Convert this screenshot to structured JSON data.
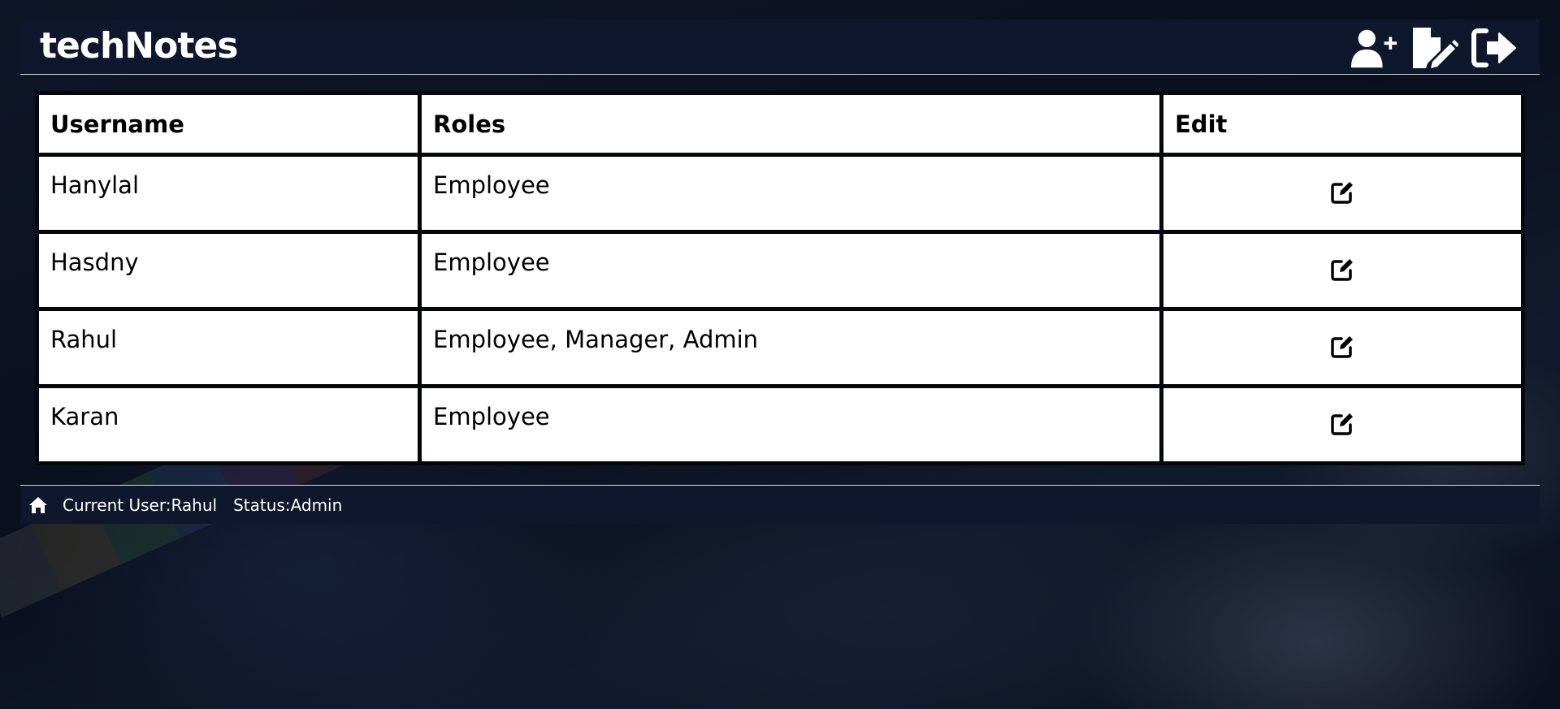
{
  "app": {
    "title": "techNotes"
  },
  "header": {
    "icons": [
      "user-plus-icon",
      "file-pen-icon",
      "logout-icon"
    ]
  },
  "table": {
    "columns": [
      "Username",
      "Roles",
      "Edit"
    ],
    "rows": [
      {
        "username": "Hanylal",
        "roles": "Employee",
        "edit_icon": "pen-to-square-icon"
      },
      {
        "username": "Hasdny",
        "roles": "Employee",
        "edit_icon": "pen-to-square-icon"
      },
      {
        "username": "Rahul",
        "roles": "Employee, Manager, Admin",
        "edit_icon": "pen-to-square-icon"
      },
      {
        "username": "Karan",
        "roles": "Employee",
        "edit_icon": "pen-to-square-icon"
      }
    ]
  },
  "footer": {
    "home_icon": "home-icon",
    "current_user": "Current User:Rahul",
    "status": "Status:Admin"
  },
  "colors": {
    "panel": "#0e172b",
    "table_cell": "#ffffff",
    "table_border": "#05070d"
  }
}
